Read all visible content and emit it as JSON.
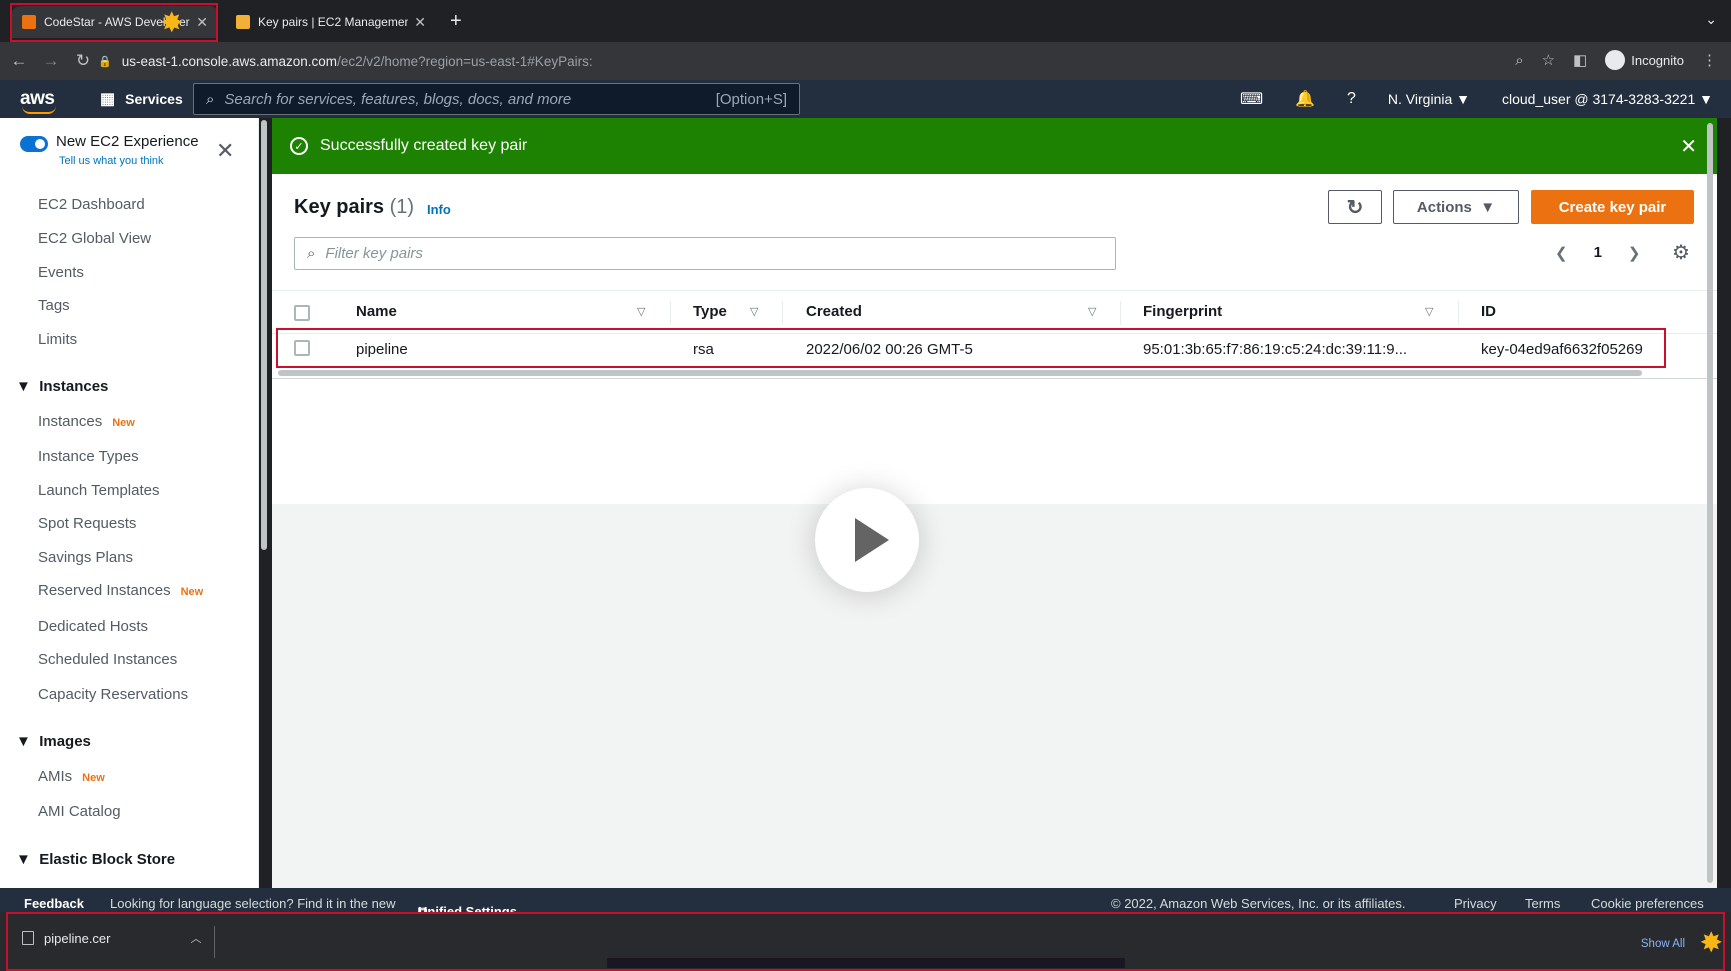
{
  "browser": {
    "tabs": [
      {
        "title": "CodeStar - AWS Developer Tools",
        "active": true
      },
      {
        "title": "Key pairs | EC2 Management Console",
        "active": false
      }
    ],
    "url_host": "us-east-1.console.aws.amazon.com",
    "url_path": "/ec2/v2/home?region=us-east-1#KeyPairs:",
    "profile": "Incognito"
  },
  "aws_header": {
    "logo": "aws",
    "services_label": "Services",
    "search_placeholder": "Search for services, features, blogs, docs, and more",
    "search_hint": "[Option+S]",
    "region": "N. Virginia",
    "account": "cloud_user @ 3174-3283-3221"
  },
  "sidebar": {
    "new_experience": "New EC2 Experience",
    "feedback_link": "Tell us what you think",
    "top_items": [
      "EC2 Dashboard",
      "EC2 Global View",
      "Events",
      "Tags",
      "Limits"
    ],
    "sections": [
      {
        "title": "Instances",
        "items": [
          {
            "label": "Instances",
            "badge": "New"
          },
          {
            "label": "Instance Types",
            "badge": ""
          },
          {
            "label": "Launch Templates",
            "badge": ""
          },
          {
            "label": "Spot Requests",
            "badge": ""
          },
          {
            "label": "Savings Plans",
            "badge": ""
          },
          {
            "label": "Reserved Instances",
            "badge": "New"
          },
          {
            "label": "Dedicated Hosts",
            "badge": ""
          },
          {
            "label": "Scheduled Instances",
            "badge": ""
          },
          {
            "label": "Capacity Reservations",
            "badge": ""
          }
        ]
      },
      {
        "title": "Images",
        "items": [
          {
            "label": "AMIs",
            "badge": "New"
          },
          {
            "label": "AMI Catalog",
            "badge": ""
          }
        ]
      },
      {
        "title": "Elastic Block Store",
        "items": []
      }
    ]
  },
  "flash": {
    "message": "Successfully created key pair",
    "status_color": "#1d8102"
  },
  "keypairs": {
    "title": "Key pairs",
    "count": "(1)",
    "info": "Info",
    "actions_label": "Actions",
    "create_label": "Create key pair",
    "filter_placeholder": "Filter key pairs",
    "page": "1",
    "columns": [
      "Name",
      "Type",
      "Created",
      "Fingerprint",
      "ID"
    ],
    "rows": [
      {
        "name": "pipeline",
        "type": "rsa",
        "created": "2022/06/02 00:26 GMT-5",
        "fingerprint": "95:01:3b:65:f7:86:19:c5:24:dc:39:11:9...",
        "id": "key-04ed9af6632f05269"
      }
    ]
  },
  "footer": {
    "feedback": "Feedback",
    "language_note": "Looking for language selection? Find it in the new",
    "unified_settings": "Unified Settings",
    "copyright": "© 2022, Amazon Web Services, Inc. or its affiliates.",
    "privacy": "Privacy",
    "terms": "Terms",
    "cookies": "Cookie preferences"
  },
  "downloads": {
    "file": "pipeline.cer",
    "show_all": "Show All"
  },
  "colors": {
    "accent_orange": "#ec7211",
    "aws_nav": "#232f3e",
    "highlight_red": "#c8102e",
    "link_blue": "#0073bb"
  }
}
